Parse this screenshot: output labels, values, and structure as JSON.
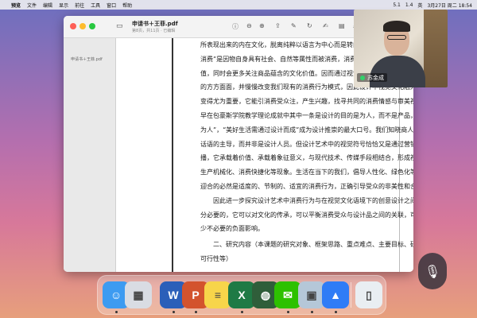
{
  "menubar": {
    "apple": "",
    "items": [
      "预览",
      "文件",
      "编辑",
      "显示",
      "前往",
      "工具",
      "窗口",
      "帮助"
    ],
    "status": [
      "5.1",
      "1.4",
      "英",
      "3月27日 周二 18:54"
    ]
  },
  "window": {
    "title": "申请书＋王菲.pdf",
    "subtitle": "第8页，共11页 · 已编辑",
    "sidebar_label": "申请书＋王菲.pdf"
  },
  "document": {
    "lines": [
      "所表现出来的内在文化，脱离纯粹以语言为中心而是转向以造型、图形的状态存在",
      "消费”是因物自身具有社会、自然等属性而被消费，消费受众考虑的不仅仅是物的",
      "值，同时会更多关注商品蕴含的文化价值。因而通过视觉符号的消费已渗透到人们生活",
      "的方方面面，并慢慢改变我们现有的消费行为模式，因此设计中视觉文化融入到视觉符号",
      "变得尤为重要，它能引消费受众注，产生兴趣，找寻共同的消费情感与审美视觉语言。",
      "早在包豪斯学院教学理论成就中其中一条是设计的目的是为人，而不是产品，因此“设计",
      "为人”，“美好生活需通过设计而成”成为设计推崇的最大口号。我们知晓商人是消费社会",
      "话语的主导，而并非是设计人员。但设计艺术中的视觉符号恰恰又是通过营销行为进行传",
      "播，它承载着价值、承载着象征意义，与现代技术、传媒手段相结合，形成视觉印象化、",
      "生产机械化、消费快捷化等现象。生活在当下的我们，倡导人性化、绿色化等设计形式，",
      "迎合的必然是适度的、节制的、适宜的消费行为，正确引导受众的非美性和合理的消费观。",
      "　　因此进一步探究设计艺术中消费行为与在视觉文化语境下的创意设计之间的联系是十",
      "分必要的，它可以对文化的传承，可以平衡消费受众与设计品之间的关联，可以规避或减",
      "少不必要的负面影响。",
      "　　二、研究内容（本课题的研究对象、框架思路、重点难点、主要目标、研究计划及其",
      "可行性等）"
    ]
  },
  "video": {
    "participant_name": "苏金成"
  },
  "dock": {
    "apps": [
      {
        "name": "Finder",
        "glyph": "☺",
        "color": "#3d9bf1"
      },
      {
        "name": "Launchpad",
        "glyph": "▦",
        "color": "#d9dce3"
      },
      {
        "name": "Word",
        "glyph": "W",
        "color": "#2b5fb9"
      },
      {
        "name": "PowerPoint",
        "glyph": "P",
        "color": "#d3532d"
      },
      {
        "name": "Notes",
        "glyph": "≡",
        "color": "#f7d54a"
      },
      {
        "name": "Excel",
        "glyph": "X",
        "color": "#1f7a45"
      },
      {
        "name": "PDF Expert",
        "glyph": "◍",
        "color": "#2f5e3a"
      },
      {
        "name": "WeChat",
        "glyph": "✉",
        "color": "#2dc100"
      },
      {
        "name": "Preview",
        "glyph": "▣",
        "color": "#b5c7d8"
      },
      {
        "name": "Tencent Meeting",
        "glyph": "▲",
        "color": "#2f7cf6"
      },
      {
        "name": "Trash",
        "glyph": "▯",
        "color": "#e9eef2"
      }
    ]
  }
}
